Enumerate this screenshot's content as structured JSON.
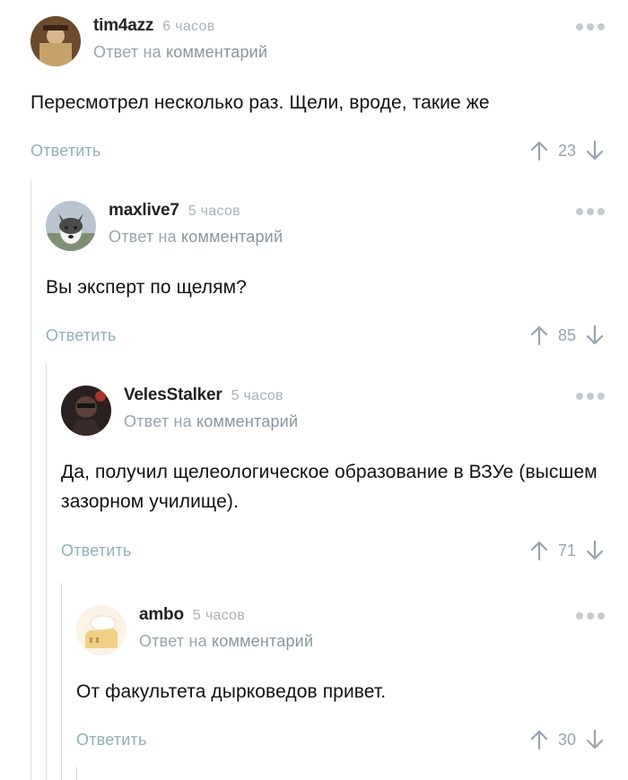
{
  "comments": [
    {
      "author": "tim4azz",
      "time": "6 часов",
      "reply_prefix": "Ответ на",
      "reply_link": "комментарий",
      "text": "Пересмотрел несколько раз. Щели, вроде, такие же",
      "reply_label": "Ответить",
      "rating": "23"
    },
    {
      "author": "maxlive7",
      "time": "5 часов",
      "reply_prefix": "Ответ на",
      "reply_link": "комментарий",
      "text": "Вы эксперт по щелям?",
      "reply_label": "Ответить",
      "rating": "85"
    },
    {
      "author": "VelesStalker",
      "time": "5 часов",
      "reply_prefix": "Ответ на",
      "reply_link": "комментарий",
      "text": "Да, получил щелеологическое образование в ВЗУе (высшем зазорном училище).",
      "reply_label": "Ответить",
      "rating": "71"
    },
    {
      "author": "ambo",
      "time": "5 часов",
      "reply_prefix": "Ответ на",
      "reply_link": "комментарий",
      "text": "От факультета дырковедов привет.",
      "reply_label": "Ответить",
      "rating": "30"
    }
  ],
  "icons": {
    "upvote": "arrow-up-icon",
    "downvote": "arrow-down-icon",
    "more": "more-dots-icon"
  }
}
